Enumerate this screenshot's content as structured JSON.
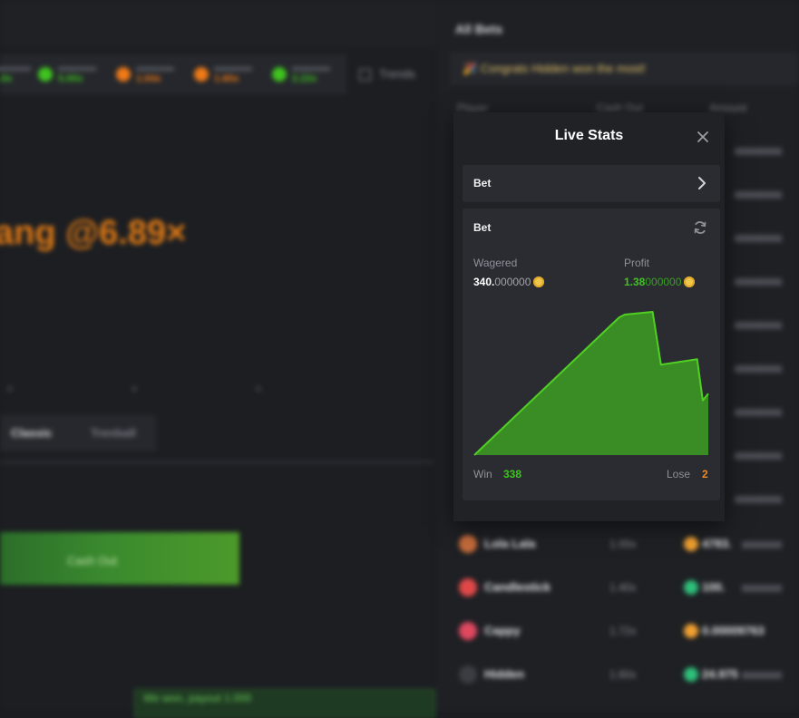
{
  "background": {
    "panel_title": "All Bets",
    "congrats_text": "🎉 Congrats Hidden won the most!",
    "columns": [
      "Player",
      "Cash Out",
      "Amount"
    ],
    "history": [
      {
        "value": "...0x",
        "color": "#3fc41f"
      },
      {
        "value": "5.00x",
        "color": "#3fc41f"
      },
      {
        "value": "1.04x",
        "color": "#f07a16"
      },
      {
        "value": "1.60x",
        "color": "#f07a16"
      },
      {
        "value": "2.22x",
        "color": "#3fc41f"
      }
    ],
    "trends_label": "Trends",
    "multiplier_text": "ang @6.89×",
    "tabs": [
      "Classic",
      "Trenball"
    ],
    "cashout_label": "Cash Out",
    "chat_text": "We won, payout 1.000",
    "rows": [
      {
        "player": "Lola Lala",
        "mult": "1.00x",
        "amount": "4783.",
        "avatar": "#c46a3a",
        "coin": "#f0a030"
      },
      {
        "player": "Candlestick",
        "mult": "1.40x",
        "amount": "100.",
        "avatar": "#e04848",
        "coin": "#2fbf7a"
      },
      {
        "player": "Cappy",
        "mult": "1.72x",
        "amount": "0.00009763",
        "avatar": "#e04860",
        "coin": "#f0a030"
      },
      {
        "player": "Hidden",
        "mult": "1.60x",
        "amount": "24.975",
        "avatar": "#3a3d42",
        "coin": "#2fbf7a"
      }
    ]
  },
  "modal": {
    "title": "Live Stats",
    "selector_label": "Bet",
    "card_title": "Bet",
    "wagered": {
      "label": "Wagered",
      "strong": "340.",
      "dim": "000000"
    },
    "profit": {
      "label": "Profit",
      "strong": "1.38",
      "dim": "000000"
    },
    "win": {
      "label": "Win",
      "value": "338"
    },
    "lose": {
      "label": "Lose",
      "value": "2"
    },
    "colors": {
      "profit": "#3fc41f",
      "lose": "#f08a24",
      "chart_fill": "#3a8c24",
      "chart_line": "#4fd023"
    }
  },
  "chart_data": {
    "type": "area",
    "title": "",
    "xlabel": "",
    "ylabel": "",
    "grid": false,
    "x": [
      0,
      52,
      54,
      64,
      67,
      80,
      82,
      84
    ],
    "values": [
      0,
      50.0,
      51.0,
      52.0,
      32.8,
      34.8,
      19.8,
      22.3
    ],
    "ylim": [
      0,
      52
    ]
  }
}
